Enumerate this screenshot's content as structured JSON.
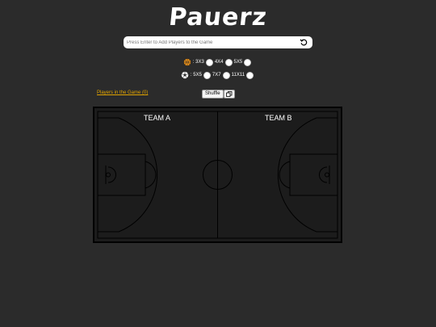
{
  "app": {
    "logo": "Pauerz"
  },
  "search": {
    "placeholder": "Press Enter to Add Players to the Game",
    "value": ""
  },
  "modes": {
    "basketball": {
      "icon": "basketball-icon",
      "options": [
        ": 3X3",
        "4X4",
        "5X5"
      ]
    },
    "soccer": {
      "icon": "soccer-ball-icon",
      "options": ": 5X5",
      "options_list": [
        ": 5X5",
        "7X7",
        "11X11"
      ]
    }
  },
  "players": {
    "link_label": "Players in the Game (0)"
  },
  "toolbar": {
    "shuffle_label": "Shuffle"
  },
  "court": {
    "team_a": "TEAM A",
    "team_b": "TEAM B"
  },
  "colors": {
    "background": "#2b2b2b",
    "court": "#1c1c1c",
    "accent": "#e0a300"
  }
}
